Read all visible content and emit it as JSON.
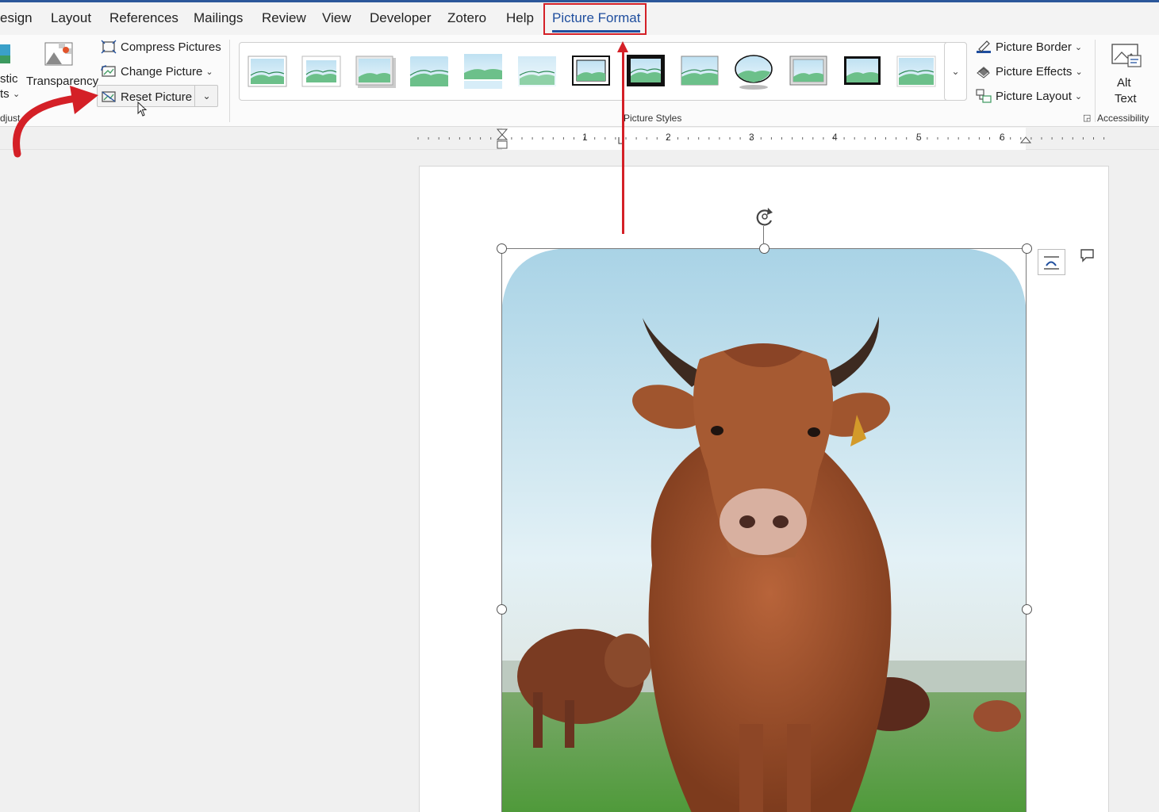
{
  "tabs": {
    "items": [
      {
        "label": "esign"
      },
      {
        "label": "Layout"
      },
      {
        "label": "References"
      },
      {
        "label": "Mailings"
      },
      {
        "label": "Review"
      },
      {
        "label": "View"
      },
      {
        "label": "Developer"
      },
      {
        "label": "Zotero"
      },
      {
        "label": "Help"
      },
      {
        "label": "Picture Format"
      }
    ],
    "active_index": 9
  },
  "adjust": {
    "artistic_label_1": "stic",
    "artistic_label_2": "ts",
    "transparency_label": "Transparency",
    "compress_label": "Compress Pictures",
    "change_label": "Change Picture",
    "reset_label": "Reset Picture",
    "group_label": "djust"
  },
  "picture_styles": {
    "group_label": "Picture Styles",
    "count": 13
  },
  "right_group": {
    "border_label": "Picture Border",
    "effects_label": "Picture Effects",
    "layout_label": "Picture Layout"
  },
  "accessibility": {
    "alt_label_1": "Alt",
    "alt_label_2": "Text",
    "group_label": "Accessibility"
  },
  "ruler": {
    "numbers": [
      "1",
      "2",
      "3",
      "4",
      "5",
      "6"
    ]
  },
  "colors": {
    "accent": "#1f4e9e",
    "annotation": "#d42027",
    "ribbon_bg": "#fbfbfb",
    "page_bg": "#ffffff"
  }
}
